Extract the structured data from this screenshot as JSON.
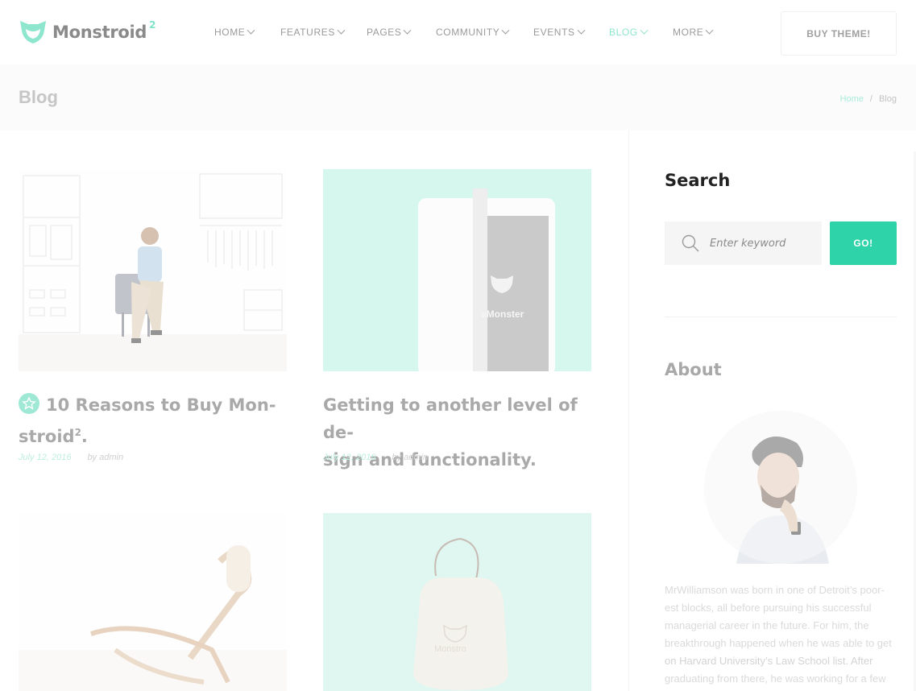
{
  "brand": {
    "name": "Monstroid",
    "superscript": "2",
    "accent_color": "#2fd3aa",
    "logo_icon": "monster-mask-icon"
  },
  "nav": {
    "items": [
      {
        "label": "HOME",
        "active": false
      },
      {
        "label": "FEATURES",
        "active": false
      },
      {
        "label": "PAGES",
        "active": false
      },
      {
        "label": "COMMUNITY",
        "active": false
      },
      {
        "label": "EVENTS",
        "active": false
      },
      {
        "label": "BLOG",
        "active": true
      },
      {
        "label": "MORE",
        "active": false
      }
    ],
    "buy_label": "BUY THEME!"
  },
  "page": {
    "title": "Blog",
    "breadcrumb": {
      "home": "Home",
      "separator": "/",
      "current": "Blog"
    }
  },
  "posts": [
    {
      "title_prefix": "10 Reasons to Buy Mon-",
      "title_rest": "stroid",
      "title_sup": "2",
      "title_end": ".",
      "date": "July 12, 2016",
      "author": "by admin",
      "featured": true,
      "image": "man-sitting-wardrobe-sketch"
    },
    {
      "title_prefix": "Getting to another level of de-",
      "title_rest": "sign and functionality.",
      "title_sup": "",
      "title_end": "",
      "date": "July 12, 2016",
      "author": "by admin",
      "featured": false,
      "image": "tablet-templatemonster"
    },
    {
      "image": "wooden-lounge-chair"
    },
    {
      "image": "monstroid-pouch"
    }
  ],
  "sidebar": {
    "search": {
      "heading": "Search",
      "placeholder": "Enter keyword",
      "button": "GO!",
      "icon": "search-icon"
    },
    "about": {
      "heading": "About",
      "lines": [
        "MrWilliamson was born in one of Detroit’s poor-",
        "est blocks, all before pursuing his successful",
        "managerial career in the future. For him, the",
        "breakthrough happened when he was able to get",
        "on Harvard University’s Law School list. After",
        "graduating from there, he was working for a few"
      ]
    }
  }
}
